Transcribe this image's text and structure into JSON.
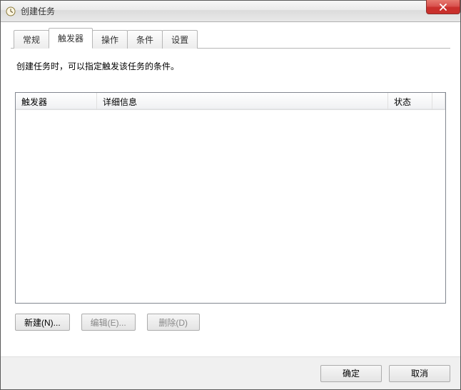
{
  "window": {
    "title": "创建任务"
  },
  "tabs": {
    "general": "常规",
    "triggers": "触发器",
    "actions": "操作",
    "conditions": "条件",
    "settings": "设置",
    "active": "triggers"
  },
  "panel": {
    "description": "创建任务时，可以指定触发该任务的条件。"
  },
  "columns": {
    "trigger": "触发器",
    "detail": "详细信息",
    "status": "状态"
  },
  "rows": [],
  "buttons": {
    "new": "新建(N)...",
    "edit": "编辑(E)...",
    "delete": "删除(D)"
  },
  "footer": {
    "ok": "确定",
    "cancel": "取消"
  }
}
